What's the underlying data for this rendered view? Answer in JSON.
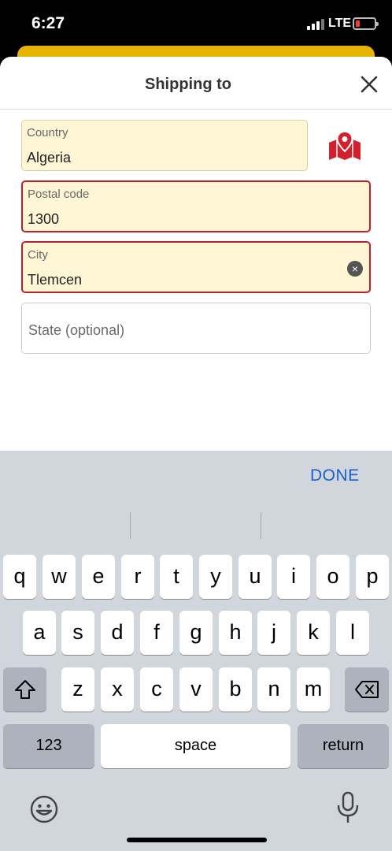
{
  "status_bar": {
    "time": "6:27",
    "network": "LTE"
  },
  "sheet": {
    "title": "Shipping to"
  },
  "fields": {
    "country": {
      "label": "Country",
      "value": "Algeria"
    },
    "postal": {
      "label": "Postal code",
      "value": "1300"
    },
    "city": {
      "label": "City",
      "value": "Tlemcen"
    },
    "state": {
      "placeholder": "State (optional)"
    }
  },
  "colors": {
    "accent_red": "#c41e2e",
    "field_bg": "#fff6d6",
    "done_blue": "#1b5fc6",
    "yellow": "#e5b300"
  },
  "keyboard": {
    "done_label": "DONE",
    "row1": [
      "q",
      "w",
      "e",
      "r",
      "t",
      "y",
      "u",
      "i",
      "o",
      "p"
    ],
    "row2": [
      "a",
      "s",
      "d",
      "f",
      "g",
      "h",
      "j",
      "k",
      "l"
    ],
    "row3": [
      "z",
      "x",
      "c",
      "v",
      "b",
      "n",
      "m"
    ],
    "numbers_label": "123",
    "space_label": "space",
    "return_label": "return"
  }
}
